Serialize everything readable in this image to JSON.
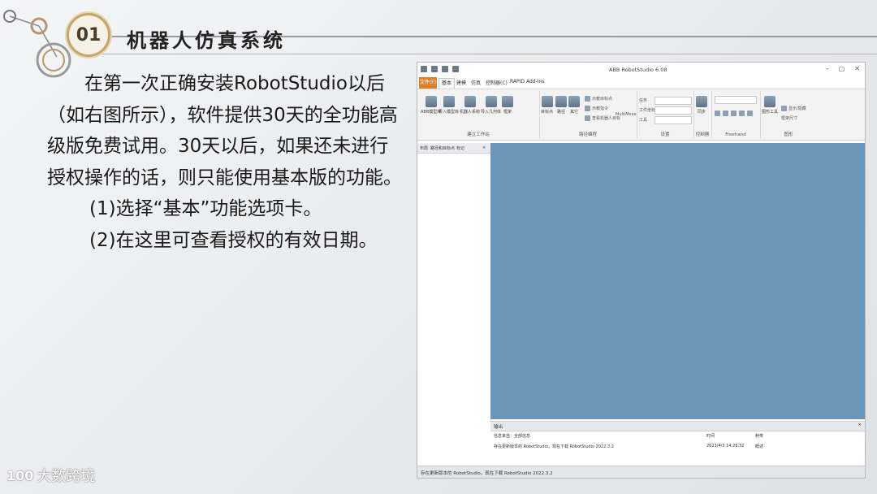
{
  "header": {
    "section_number": "01",
    "title": "机器人仿真系统"
  },
  "body": {
    "paragraph": "在第一次正确安装RobotStudio以后（如右图所示），软件提供30天的全功能高级版免费试用。30天以后，如果还未进行授权操作的话，则只能使用基本版的功能。",
    "step1": "(1)选择“基本”功能选项卡。",
    "step2": "(2)在这里可查看授权的有效日期。"
  },
  "watermark": {
    "logo": "100",
    "text": "大数跨境"
  },
  "app": {
    "window_title": "ABB RobotStudio 6.08",
    "tabs": [
      "文件(F)",
      "基本",
      "建模",
      "仿真",
      "控制器(C)",
      "RAPID",
      "Add-Ins"
    ],
    "ribbon_groups": {
      "build_station": {
        "label": "建立工作站",
        "buttons": [
          "ABB模型库",
          "导入模型库",
          "机器人系统",
          "导入几何体",
          "框架",
          "目标点",
          "路径",
          "其它"
        ]
      },
      "path_programming": {
        "label": "路径编程",
        "items": [
          "示教目标点",
          "示教指令",
          "查看机器人目标"
        ],
        "multimove": "MultiMove"
      },
      "settings": {
        "label": "设置",
        "fields": [
          "任务",
          "工件坐标",
          "工具"
        ]
      },
      "controller": {
        "label": "控制器",
        "button": "同步"
      },
      "freehand": {
        "label": "Freehand"
      },
      "graphics": {
        "label": "图形",
        "button": "图形工具",
        "items": [
          "显示/隐藏",
          "框架尺寸"
        ]
      }
    },
    "left_panel_tabs": [
      "布局",
      "路径和目标点",
      "标记"
    ],
    "output": {
      "title": "输出",
      "filter_label": "信息来自：全部信息",
      "col_time": "时间",
      "col_type": "种类",
      "message": "存在更新版本的 RobotStudio，现在下载 RobotStudio 2022.3.2",
      "time": "2023/4/3 14:26:32",
      "category": "概述"
    },
    "status_bar": "存在更新版本的 RobotStudio，现在下载 RobotStudio 2022.3.2",
    "colors": {
      "viewport": "#6a96b9",
      "file_tab": "#d9822b"
    }
  }
}
